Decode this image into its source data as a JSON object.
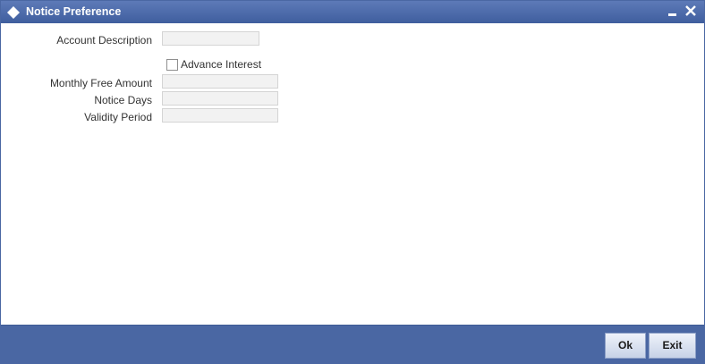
{
  "window": {
    "title": "Notice Preference",
    "icons": {
      "app": "diamond-icon",
      "minimize": "minimize-icon",
      "close": "close-icon"
    }
  },
  "form": {
    "account_description": {
      "label": "Account Description",
      "value": ""
    },
    "advance_interest": {
      "label": "Advance Interest",
      "checked": false
    },
    "monthly_free_amount": {
      "label": "Monthly Free Amount",
      "value": ""
    },
    "notice_days": {
      "label": "Notice Days",
      "value": ""
    },
    "validity_period": {
      "label": "Validity Period",
      "value": ""
    }
  },
  "footer": {
    "ok_label": "Ok",
    "exit_label": "Exit"
  },
  "colors": {
    "titlebar": "#4a67a3",
    "footer": "#4a67a3",
    "field_bg": "#f2f2f2"
  }
}
